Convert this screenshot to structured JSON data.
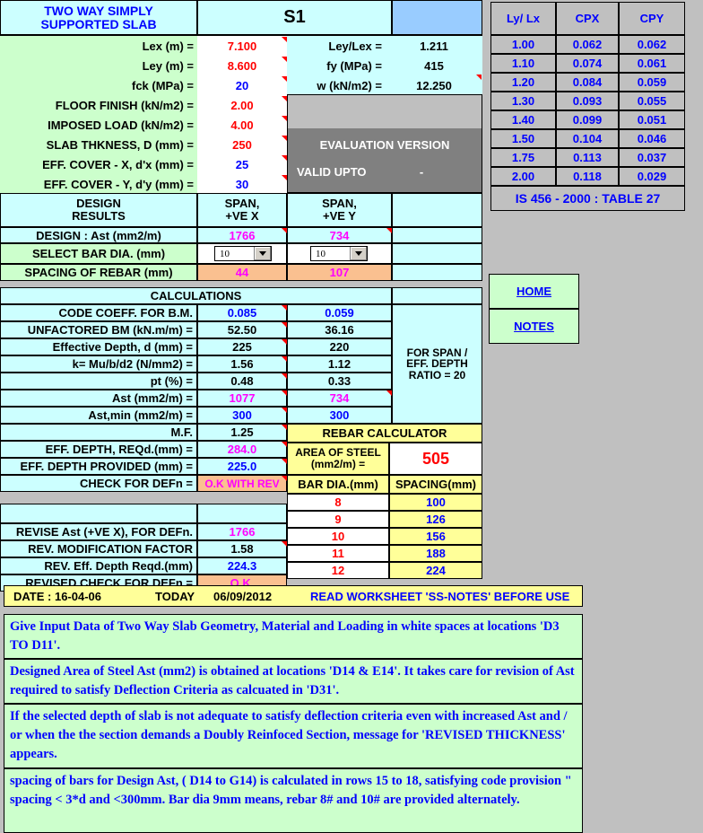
{
  "header": {
    "title_line1": "TWO WAY SIMPLY",
    "title_line2": "SUPPORTED  SLAB",
    "slab_id": "S1"
  },
  "inputs": {
    "rows": [
      {
        "label": "Lex (m) =",
        "value": "7.100",
        "color": "#ff0000"
      },
      {
        "label": "Ley (m) =",
        "value": "8.600",
        "color": "#ff0000"
      },
      {
        "label": "fck (MPa) =",
        "value": "20",
        "color": "#0000ff"
      },
      {
        "label": "FLOOR FINISH (kN/m2) =",
        "value": "2.00",
        "color": "#ff0000"
      },
      {
        "label": "IMPOSED LOAD (kN/m2) =",
        "value": "4.00",
        "color": "#ff0000"
      },
      {
        "label": "SLAB THKNESS, D (mm) =",
        "value": "250",
        "color": "#ff0000"
      },
      {
        "label": "EFF. COVER - X, d'x (mm) =",
        "value": "25",
        "color": "#0000ff"
      },
      {
        "label": "EFF. COVER - Y, d'y (mm) =",
        "value": "30",
        "color": "#0000ff"
      }
    ]
  },
  "derived": {
    "rows": [
      {
        "label": "Ley/Lex =",
        "value": "1.211"
      },
      {
        "label": "fy (MPa) =",
        "value": "415"
      },
      {
        "label": "w (kN/m2) =",
        "value": "12.250"
      }
    ]
  },
  "evaluation": {
    "line1": "EVALUATION VERSION",
    "line2": "VALID UPTO",
    "line2_value": "-"
  },
  "design_results": {
    "title_line1": "DESIGN",
    "title_line2": "RESULTS",
    "col_x_line1": "SPAN,",
    "col_x_line2": "+VE X",
    "col_y_line1": "SPAN,",
    "col_y_line2": "+VE Y",
    "ast_label": "DESIGN : Ast (mm2/m)",
    "ast_x": "1766",
    "ast_y": "734",
    "bar_dia_label": "SELECT BAR DIA. (mm)",
    "bar_dia_x": "10",
    "bar_dia_y": "10",
    "spacing_label": "SPACING OF REBAR (mm)",
    "spacing_x": "44",
    "spacing_y": "107"
  },
  "calculations": {
    "title": "CALCULATIONS",
    "rows": [
      {
        "label": "CODE COEFF. FOR B.M.",
        "x": "0.085",
        "y": "0.059",
        "xcolor": "#0000ff",
        "ycolor": "#0000ff"
      },
      {
        "label": "UNFACTORED BM (kN.m/m) =",
        "x": "52.50",
        "y": "36.16",
        "xcolor": "#000000",
        "ycolor": "#000000"
      },
      {
        "label": "Effective Depth, d (mm) =",
        "x": "225",
        "y": "220",
        "xcolor": "#000000",
        "ycolor": "#000000"
      },
      {
        "label": "k= Mu/b/d2 (N/mm2) =",
        "x": "1.56",
        "y": "1.12",
        "xcolor": "#000000",
        "ycolor": "#000000"
      },
      {
        "label": "pt (%) =",
        "x": "0.48",
        "y": "0.33",
        "xcolor": "#000000",
        "ycolor": "#000000"
      },
      {
        "label": "Ast (mm2/m) =",
        "x": "1077",
        "y": "734",
        "xcolor": "#ff00ff",
        "ycolor": "#ff00ff"
      },
      {
        "label": "Ast,min (mm2/m) =",
        "x": "300",
        "y": "300",
        "xcolor": "#0000ff",
        "ycolor": "#0000ff"
      }
    ],
    "side_note_line1": "FOR SPAN /",
    "side_note_line2": "EFF. DEPTH",
    "side_note_line3": "RATIO = 20"
  },
  "deflection": {
    "rows": [
      {
        "label": "M.F.",
        "value": "1.25",
        "color": "#000000"
      },
      {
        "label": "EFF. DEPTH, REQd.(mm) =",
        "value": "284.0",
        "color": "#ff00ff"
      },
      {
        "label": "EFF. DEPTH PROVIDED (mm) =",
        "value": "225.0",
        "color": "#0000ff"
      },
      {
        "label": "CHECK FOR DEFn =",
        "value": "O.K WITH REV",
        "color": "#ff00ff"
      }
    ],
    "rows2": [
      {
        "label": "REVISE Ast (+VE X), FOR DEFn.",
        "value": "1766",
        "color": "#ff00ff"
      },
      {
        "label": "REV. MODIFICATION FACTOR",
        "value": "1.58",
        "color": "#000000"
      },
      {
        "label": "REV. Eff. Depth Reqd.(mm)",
        "value": "224.3",
        "color": "#0000ff"
      },
      {
        "label": "REVISED CHECK FOR DEFn =",
        "value": "O.K.",
        "color": "#ff00ff"
      }
    ]
  },
  "rebar_calculator": {
    "title": "REBAR CALCULATOR",
    "area_label_line1": "AREA OF STEEL",
    "area_label_line2": "(mm2/m) =",
    "area_value": "505",
    "col1": "BAR DIA.(mm)",
    "col2": "SPACING(mm)",
    "rows": [
      {
        "dia": "8",
        "spacing": "100"
      },
      {
        "dia": "9",
        "spacing": "126"
      },
      {
        "dia": "10",
        "spacing": "156"
      },
      {
        "dia": "11",
        "spacing": "188"
      },
      {
        "dia": "12",
        "spacing": "224"
      }
    ]
  },
  "code_table": {
    "headers": [
      "Ly/ Lx",
      "CPX",
      "CPY"
    ],
    "rows": [
      {
        "lylx": "1.00",
        "cpx": "0.062",
        "cpy": "0.062"
      },
      {
        "lylx": "1.10",
        "cpx": "0.074",
        "cpy": "0.061"
      },
      {
        "lylx": "1.20",
        "cpx": "0.084",
        "cpy": "0.059"
      },
      {
        "lylx": "1.30",
        "cpx": "0.093",
        "cpy": "0.055"
      },
      {
        "lylx": "1.40",
        "cpx": "0.099",
        "cpy": "0.051"
      },
      {
        "lylx": "1.50",
        "cpx": "0.104",
        "cpy": "0.046"
      },
      {
        "lylx": "1.75",
        "cpx": "0.113",
        "cpy": "0.037"
      },
      {
        "lylx": "2.00",
        "cpx": "0.118",
        "cpy": "0.029"
      }
    ],
    "footer": "IS 456 - 2000 : TABLE 27"
  },
  "nav": {
    "home": "HOME",
    "notes": "NOTES"
  },
  "status_bar": {
    "date_label": "DATE : 16-04-06",
    "today_label": "TODAY",
    "today_value": "06/09/2012",
    "message": "READ WORKSHEET 'SS-NOTES' BEFORE USE"
  },
  "notes": [
    "Give Input Data of Two Way Slab Geometry, Material and Loading in white spaces at locations 'D3 TO D11'.",
    "Designed Area of Steel Ast (mm2) is obtained at locations 'D14 & E14'. It takes care for revision of Ast required to satisfy Deflection Criteria as calcuated in 'D31'.",
    "If the selected depth of slab is not adequate to satisfy deflection criteria even with increased Ast and / or when the the section demands a Doubly Reinfoced Section, message for 'REVISED THICKNESS' appears.",
    "spacing of bars for Design Ast, ( D14 to G14) is calculated in rows 15 to 18, satisfying code provision \" spacing < 3*d and <300mm. Bar dia 9mm means, rebar 8# and 10# are provided alternately."
  ],
  "colors": {
    "accent_blue": "#0000ff",
    "accent_red": "#ff0000",
    "accent_magenta": "#ff00ff",
    "cyan_fill": "#ccffff",
    "green_fill": "#ccffcc",
    "yellow_fill": "#ffff99",
    "orange_fill": "#fac090"
  }
}
